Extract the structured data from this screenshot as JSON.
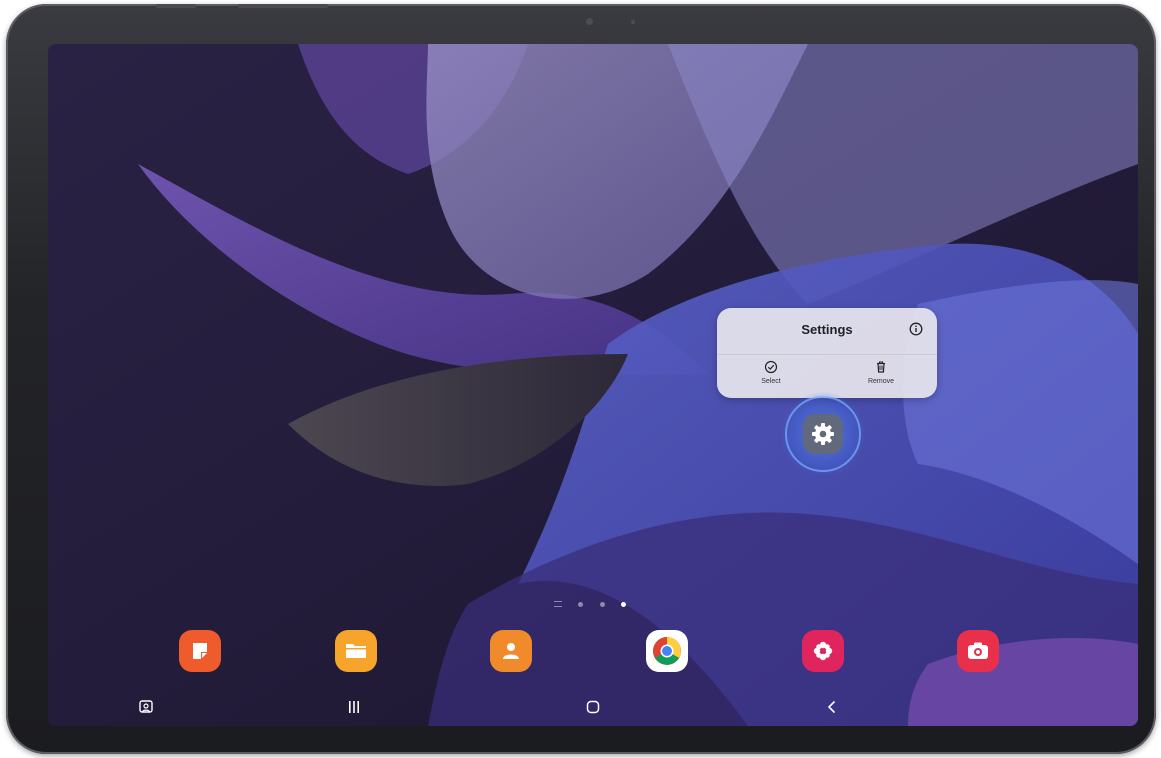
{
  "popup": {
    "title": "Settings",
    "actions": [
      {
        "label": "Select",
        "icon": "check-circle-icon"
      },
      {
        "label": "Remove",
        "icon": "trash-icon"
      }
    ],
    "info_icon": "info-icon"
  },
  "pressed_app": {
    "icon": "gear-icon",
    "color": "#62697d"
  },
  "page_indicator": {
    "pages": 3,
    "active": 3
  },
  "dock": [
    {
      "icon": "samsung-notes-icon",
      "color": "#ef5b2b"
    },
    {
      "icon": "my-files-icon",
      "color": "#f7a52a"
    },
    {
      "icon": "contacts-icon",
      "color": "#f08a2a"
    },
    {
      "icon": "chrome-icon",
      "color": "#ffffff"
    },
    {
      "icon": "gallery-icon",
      "color": "#e0245e"
    },
    {
      "icon": "camera-icon",
      "color": "#e8304a"
    }
  ],
  "navbar": [
    {
      "icon": "screenshot-toolbar-icon"
    },
    {
      "icon": "recents-icon"
    },
    {
      "icon": "home-icon"
    },
    {
      "icon": "back-icon"
    }
  ],
  "colors": {
    "wallpaper_base": "#221b38",
    "popup_bg": "#e4e2ec",
    "highlight": "#5a96ff"
  }
}
